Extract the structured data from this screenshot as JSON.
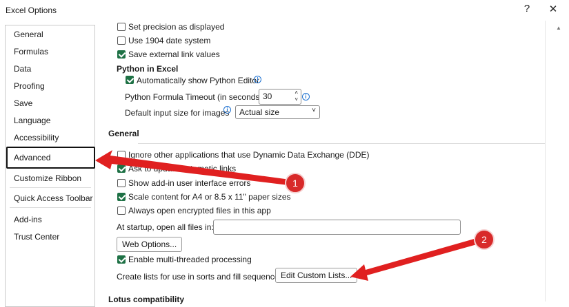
{
  "window": {
    "title": "Excel Options",
    "help": "?",
    "close": "✕"
  },
  "sidebar": {
    "items": [
      "General",
      "Formulas",
      "Data",
      "Proofing",
      "Save",
      "Language",
      "Accessibility",
      "Advanced",
      "Customize Ribbon",
      "Quick Access Toolbar",
      "Add-ins",
      "Trust Center"
    ],
    "selected": "Advanced"
  },
  "content": {
    "set_precision": "Set precision as displayed",
    "use_1904": "Use 1904 date system",
    "save_external": "Save external link values",
    "python_heading": "Python in Excel",
    "auto_python_editor": "Automatically show Python Editor",
    "python_timeout_label": "Python Formula Timeout (in seconds)",
    "python_timeout_value": "30",
    "image_size_label": "Default input size for images",
    "image_size_value": "Actual size",
    "general_heading": "General",
    "ignore_dde": "Ignore other applications that use Dynamic Data Exchange (DDE)",
    "ask_update_links": "Ask to update automatic links",
    "show_addin_errors": "Show add-in user interface errors",
    "scale_content": "Scale content for A4 or 8.5 x 11\" paper sizes",
    "always_open_encrypted": "Always open encrypted files in this app",
    "startup_label": "At startup, open all files in:",
    "startup_value": "",
    "web_options": "Web Options...",
    "multithreaded": "Enable multi-threaded processing",
    "custom_lists_label": "Create lists for use in sorts and fill sequences:",
    "edit_custom_lists": "Edit Custom Lists...",
    "lotus_heading": "Lotus compatibility"
  },
  "annotations": {
    "badge1": "1",
    "badge2": "2",
    "color": "#e02020"
  }
}
